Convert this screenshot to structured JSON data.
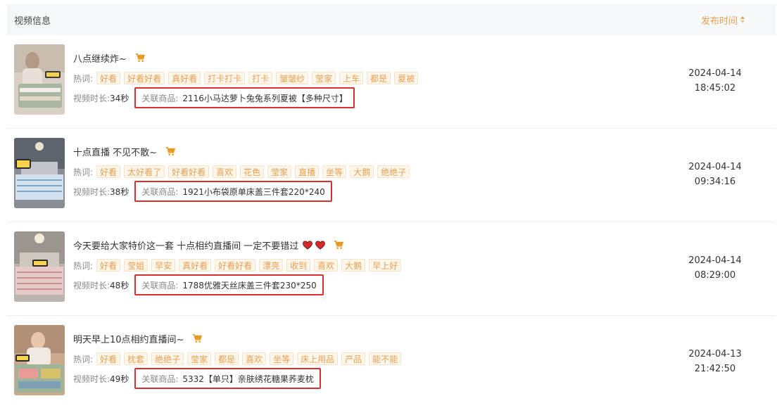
{
  "header": {
    "title": "视频信息",
    "sort_label": "发布时间"
  },
  "labels": {
    "hot_words": "热词:",
    "duration": "视频时长:",
    "product": "关联商品:"
  },
  "colors": {
    "accent": "#e8a052",
    "tag_bg": "#fdf6ea",
    "highlight_border": "#d63030"
  },
  "rows": [
    {
      "title": "八点继续炸~",
      "tags": [
        "好看",
        "好看好看",
        "真好看",
        "打卡打卡",
        "打卡",
        "皱皱纱",
        "莹家",
        "上车",
        "都是",
        "夏被"
      ],
      "duration": "34秒",
      "product": "2116小马达萝卜兔兔系列夏被【多种尺寸】",
      "date": "2024-04-14",
      "clock": "18:45:02"
    },
    {
      "title": "十点直播 不见不散~",
      "tags": [
        "好看",
        "太好看了",
        "好看好看",
        "喜欢",
        "花色",
        "莹家",
        "直播",
        "坐等",
        "大鹅",
        "绝绝子"
      ],
      "duration": "38秒",
      "product": "1921小布袋原单床盖三件套220*240",
      "date": "2024-04-14",
      "clock": "09:34:16"
    },
    {
      "title": "今天要给大家特价这一套 十点相约直播间 一定不要错过",
      "tags": [
        "好看",
        "莹姐",
        "早安",
        "真好看",
        "好看好看",
        "漂亮",
        "收到",
        "喜欢",
        "大鹅",
        "早上好"
      ],
      "duration": "48秒",
      "product": "1788优雅天丝床盖三件套230*250",
      "date": "2024-04-14",
      "clock": "08:29:00"
    },
    {
      "title": "明天早上10点相约直播间~",
      "tags": [
        "好看",
        "枕套",
        "绝绝子",
        "莹家",
        "都是",
        "喜欢",
        "坐等",
        "床上用品",
        "产品",
        "能不能"
      ],
      "duration": "49秒",
      "product": "5332【单只】亲肤绣花糖果荞麦枕",
      "date": "2024-04-13",
      "clock": "21:42:50"
    }
  ]
}
